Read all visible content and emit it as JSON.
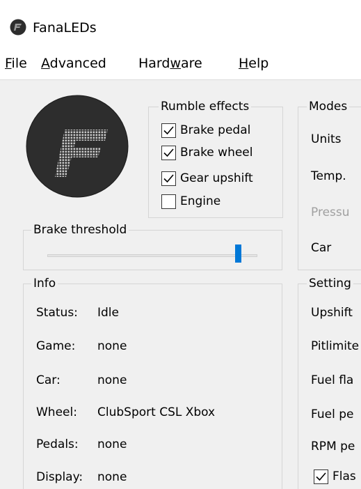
{
  "window": {
    "title": "FanaLEDs"
  },
  "menu": {
    "file": {
      "pre": "",
      "key": "F",
      "post": "ile"
    },
    "advanced": {
      "pre": "",
      "key": "A",
      "post": "dvanced"
    },
    "hardware": {
      "pre": "Hard",
      "key": "w",
      "post": "are"
    },
    "help": {
      "pre": "",
      "key": "H",
      "post": "elp"
    }
  },
  "rumble": {
    "title": "Rumble effects",
    "items": [
      {
        "label": "Brake pedal",
        "checked": true
      },
      {
        "label": "Brake wheel",
        "checked": true
      },
      {
        "label": "Gear upshift",
        "checked": true
      },
      {
        "label": "Engine",
        "checked": false
      }
    ]
  },
  "modes": {
    "title": "Modes",
    "rows": [
      "Units",
      "Temp.",
      "Pressu",
      "Car"
    ]
  },
  "brake": {
    "title": "Brake threshold",
    "value_fraction": 0.92
  },
  "info": {
    "title": "Info",
    "rows": [
      {
        "label": "Status:",
        "value": "Idle"
      },
      {
        "label": "Game:",
        "value": "none"
      },
      {
        "label": "Car:",
        "value": "none"
      },
      {
        "label": "Wheel:",
        "value": "ClubSport CSL Xbox"
      },
      {
        "label": "Pedals:",
        "value": "none"
      },
      {
        "label": "Display:",
        "value": "none"
      }
    ]
  },
  "settings": {
    "title": "Setting",
    "rows": [
      "Upshift",
      "Pitlimite",
      "Fuel fla",
      "Fuel pe",
      "RPM pe"
    ],
    "flash": {
      "label": "Flas",
      "checked": true
    }
  },
  "colors": {
    "accent": "#0078d7",
    "background": "#f0f0f0",
    "logo_bg": "#2d2d2d"
  }
}
